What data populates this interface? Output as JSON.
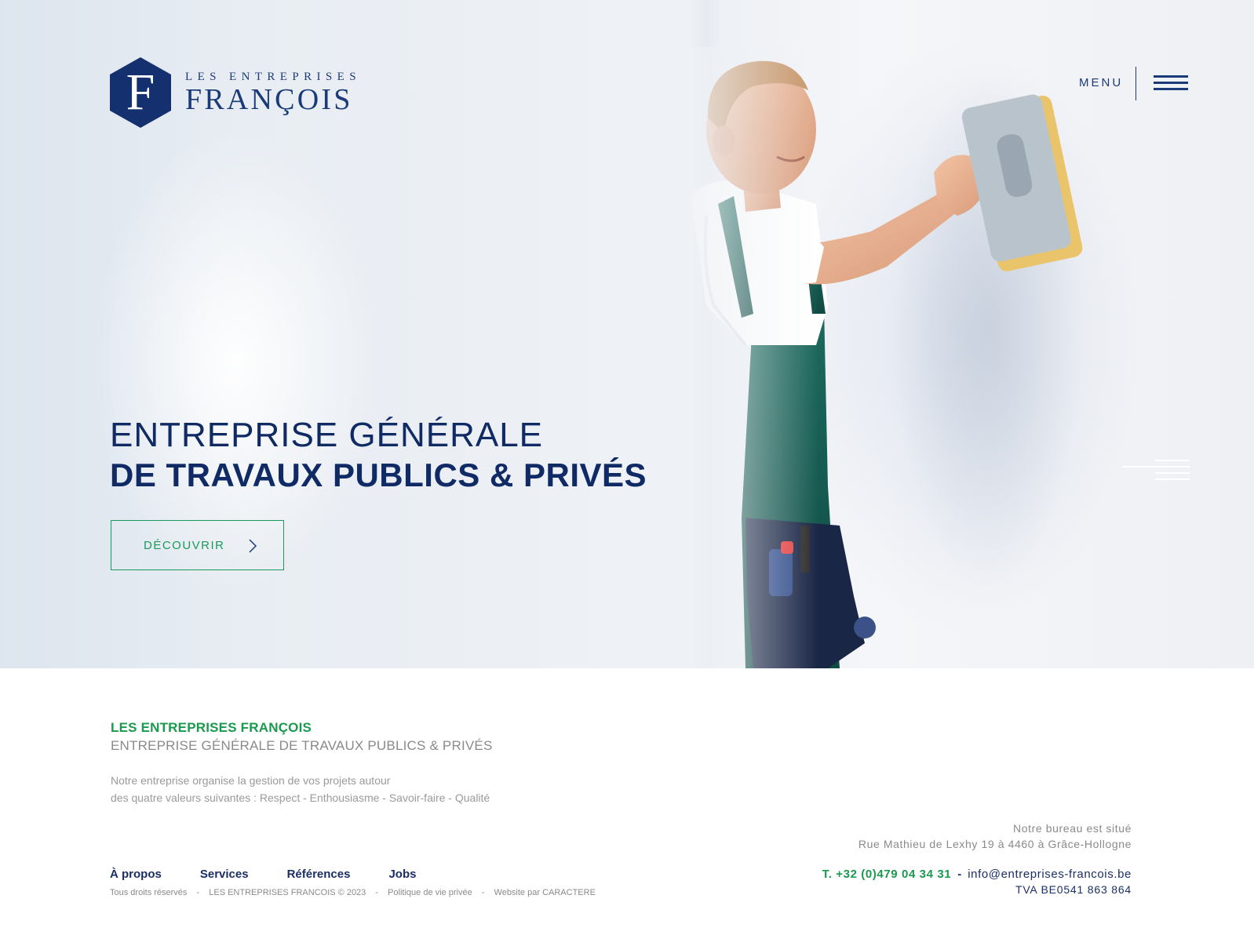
{
  "colors": {
    "navy": "#1b3a78",
    "navy_dark": "#0f2a65",
    "green": "#1a9a4e",
    "grey": "#8a8a8a"
  },
  "header": {
    "logo": {
      "letter": "F",
      "line1": "LES ENTREPRISES",
      "line2": "FRANÇOIS"
    },
    "menu_label": "MENU",
    "menu_icon": "hamburger-icon"
  },
  "hero": {
    "title_line1": "ENTREPRISE GÉNÉRALE",
    "title_line2": "DE TRAVAUX PUBLICS & PRIVÉS",
    "cta_label": "DÉCOUVRIR",
    "cta_icon": "chevron-right-icon",
    "slider_icon": "slider-lines-icon"
  },
  "footer": {
    "brand": "LES ENTREPRISES FRANÇOIS",
    "tagline": "ENTREPRISE GÉNÉRALE DE TRAVAUX PUBLICS & PRIVÉS",
    "description_line1": "Notre entreprise organise la gestion de vos projets autour",
    "description_line2": "des quatre valeurs suivantes : Respect - Enthousiasme - Savoir-faire - Qualité",
    "office_line1": "Notre bureau est situé",
    "office_line2": "Rue Mathieu de Lexhy 19 à 4460 à Grâce-Hollogne",
    "nav": [
      "À propos",
      "Services",
      "Références",
      "Jobs"
    ],
    "legal": {
      "rights": "Tous droits réservés",
      "copyright": "LES ENTREPRISES FRANCOIS © 2023",
      "privacy": "Politique de vie privée",
      "credit": "Website par CARACTERE",
      "separator": "-"
    },
    "phone": "T. +32 (0)479 04 34 31",
    "contact_separator": "-",
    "email": "info@entreprises-francois.be",
    "tva": "TVA BE0541 863 864"
  }
}
